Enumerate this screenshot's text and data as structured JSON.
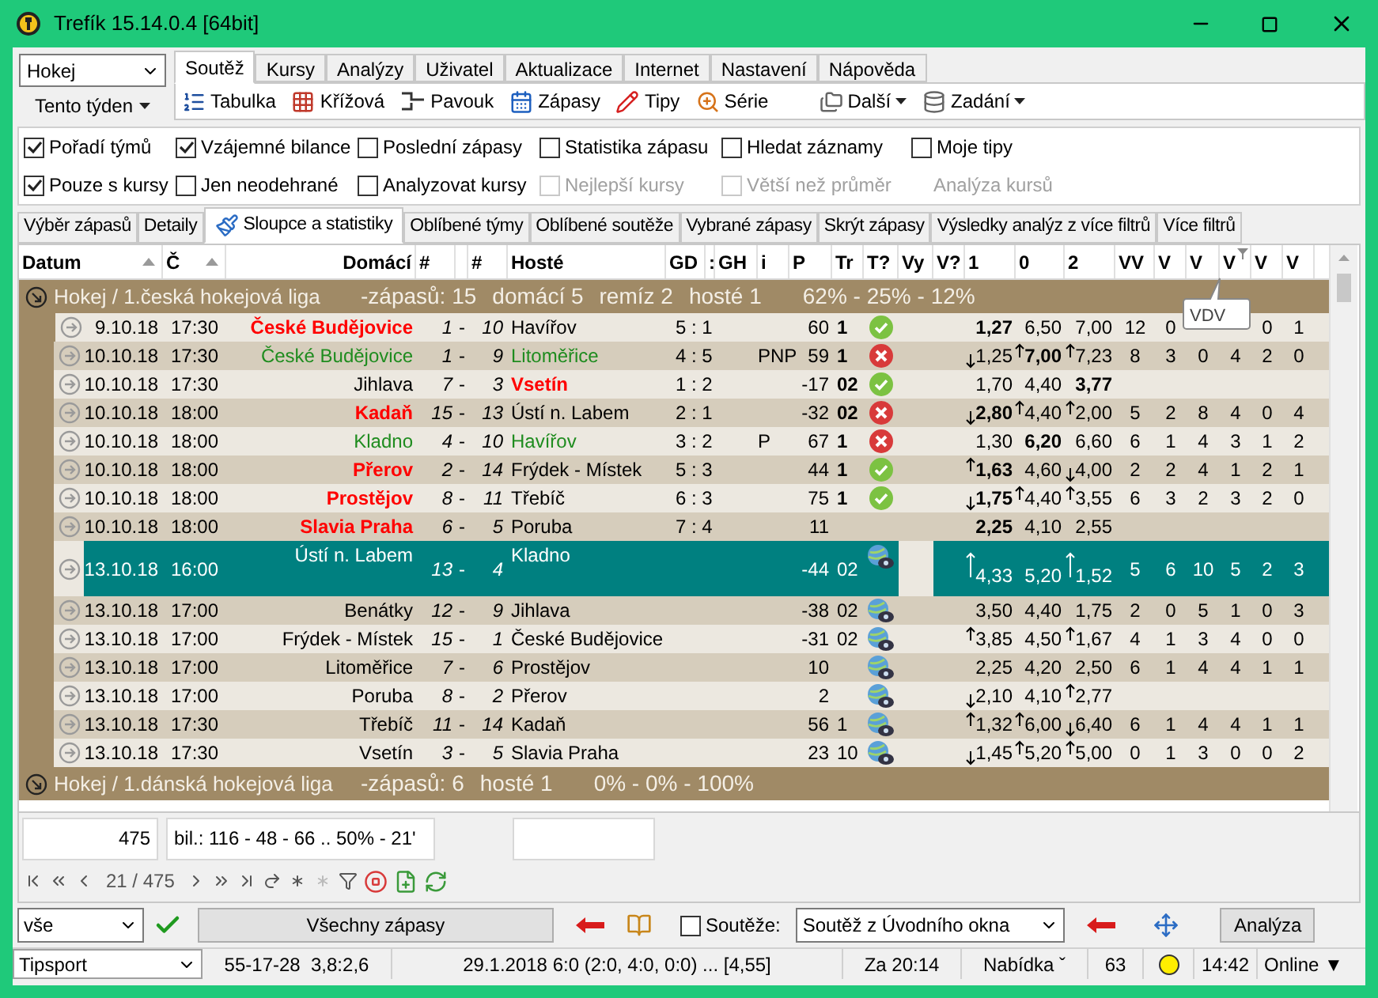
{
  "window": {
    "title": "Trefík 15.14.0.4 [64bit]"
  },
  "sport_select": {
    "value": "Hokej"
  },
  "period_button": {
    "label": "Tento týden"
  },
  "menu_tabs": [
    {
      "label": "Soutěž",
      "selected": true
    },
    {
      "label": "Kursy",
      "selected": false
    },
    {
      "label": "Analýzy",
      "selected": false
    },
    {
      "label": "Uživatel",
      "selected": false
    },
    {
      "label": "Aktualizace",
      "selected": false
    },
    {
      "label": "Internet",
      "selected": false
    },
    {
      "label": "Nastavení",
      "selected": false
    },
    {
      "label": "Nápověda",
      "selected": false
    }
  ],
  "toolbar": [
    {
      "label": "Tabulka",
      "dropdown": false
    },
    {
      "label": "Křížová",
      "dropdown": false
    },
    {
      "label": "Pavouk",
      "dropdown": false
    },
    {
      "label": "Zápasy",
      "dropdown": false
    },
    {
      "label": "Tipy",
      "dropdown": false
    },
    {
      "label": "Série",
      "dropdown": false
    },
    {
      "label": "Další",
      "dropdown": true
    },
    {
      "label": "Zadání",
      "dropdown": true
    }
  ],
  "options": [
    {
      "kind": "checkbox",
      "label": "Pořadí týmů",
      "checked": true,
      "disabled": false
    },
    {
      "kind": "checkbox",
      "label": "Vzájemné bilance",
      "checked": true,
      "disabled": false
    },
    {
      "kind": "checkbox",
      "label": "Poslední zápasy",
      "checked": false,
      "disabled": false
    },
    {
      "kind": "checkbox",
      "label": "Statistika zápasu",
      "checked": false,
      "disabled": false
    },
    {
      "kind": "checkbox",
      "label": "Hledat záznamy",
      "checked": false,
      "disabled": false
    },
    {
      "kind": "checkbox",
      "label": "Moje tipy",
      "checked": false,
      "disabled": false
    },
    {
      "kind": "checkbox",
      "label": "Pouze s kursy",
      "checked": true,
      "disabled": false
    },
    {
      "kind": "checkbox",
      "label": "Jen neodehrané",
      "checked": false,
      "disabled": false
    },
    {
      "kind": "checkbox",
      "label": "Analyzovat kursy",
      "checked": false,
      "disabled": false
    },
    {
      "kind": "checkbox",
      "label": "Nejlepší kursy",
      "checked": false,
      "disabled": true
    },
    {
      "kind": "checkbox",
      "label": "Větší než průměr",
      "checked": false,
      "disabled": true
    },
    {
      "kind": "label",
      "label": "Analýza kursů"
    }
  ],
  "sub_tabs": [
    {
      "label": "Výběr zápasů",
      "selected": false
    },
    {
      "label": "Detaily",
      "selected": false
    },
    {
      "label": "Sloupce a statistiky",
      "selected": true
    },
    {
      "label": "Oblíbené týmy",
      "selected": false
    },
    {
      "label": "Oblíbené soutěže",
      "selected": false
    },
    {
      "label": "Vybrané zápasy",
      "selected": false
    },
    {
      "label": "Skrýt zápasy",
      "selected": false
    },
    {
      "label": "Výsledky analýz z více filtrů",
      "selected": false
    },
    {
      "label": "Více filtrů",
      "selected": false
    }
  ],
  "table": {
    "columns": [
      {
        "label": "Datum",
        "sorted": true,
        "filtered": false
      },
      {
        "label": "Č",
        "sorted": true,
        "filtered": false
      },
      {
        "label": "Domácí",
        "sorted": false,
        "filtered": false
      },
      {
        "label": "#",
        "sorted": false,
        "filtered": false
      },
      {
        "sorted": false,
        "filtered": false
      },
      {
        "label": "#",
        "sorted": false,
        "filtered": false
      },
      {
        "label": "Hosté",
        "sorted": false,
        "filtered": false
      },
      {
        "label": "GD",
        "sorted": false,
        "filtered": false
      },
      {
        "label": ":",
        "sorted": false,
        "filtered": false
      },
      {
        "label": "GH",
        "sorted": false,
        "filtered": false
      },
      {
        "label": "i",
        "sorted": false,
        "filtered": false
      },
      {
        "label": "P",
        "sorted": false,
        "filtered": false
      },
      {
        "label": "Tr",
        "sorted": false,
        "filtered": false
      },
      {
        "label": "T?",
        "sorted": false,
        "filtered": false
      },
      {
        "label": "Vy",
        "sorted": false,
        "filtered": false
      },
      {
        "label": "V?",
        "sorted": false,
        "filtered": false
      },
      {
        "label": "1",
        "sorted": false,
        "filtered": false
      },
      {
        "label": "0",
        "sorted": false,
        "filtered": false
      },
      {
        "label": "2",
        "sorted": false,
        "filtered": false
      },
      {
        "label": "VV",
        "sorted": false,
        "filtered": false
      },
      {
        "label": "V",
        "sorted": false,
        "filtered": false
      },
      {
        "label": "V",
        "sorted": false,
        "filtered": false
      },
      {
        "label": "V",
        "sorted": false,
        "filtered": true
      },
      {
        "label": "V",
        "sorted": false,
        "filtered": false
      },
      {
        "label": "V",
        "sorted": false,
        "filtered": false
      }
    ],
    "groups": [
      {
        "title": "Hokej / 1.česká hokejová liga",
        "stats": [
          "-zápasů: 15",
          "domácí 5",
          "remíz 2",
          "hosté 1",
          "62% - 25% - 12%"
        ],
        "rows": [
          {
            "selected": false,
            "date": "9.10.18",
            "time": "17:30",
            "home": "České Budějovice",
            "home_red": true,
            "home_green": false,
            "home_score": "1",
            "sep": "-",
            "away_score": "10",
            "away": "Havířov",
            "away_red": false,
            "away_green": false,
            "gd": "5 : 1",
            "p": "60",
            "tr": "1",
            "result": {
              "kind": "ok"
            },
            "odds": [
              {
                "v": "1,27",
                "bold": true,
                "rising": false,
                "falling": false
              },
              {
                "v": "6,50",
                "bold": false,
                "rising": false,
                "falling": false
              },
              {
                "v": "7,00",
                "bold": false,
                "rising": false,
                "falling": false
              }
            ],
            "v": [
              "12",
              "0"
            ],
            "v_end": [
              "0",
              "1"
            ]
          },
          {
            "selected": false,
            "date": "10.10.18",
            "time": "17:30",
            "home": "České Budějovice",
            "home_red": false,
            "home_green": true,
            "home_score": "1",
            "sep": "-",
            "away_score": "9",
            "away": "Litoměřice",
            "away_red": false,
            "away_green": true,
            "gd": "4 : 5",
            "i": "PNP",
            "p": "59",
            "tr": "1",
            "result": {
              "kind": "fail"
            },
            "odds": [
              {
                "v": "1,25",
                "bold": false,
                "rising": false,
                "falling": true
              },
              {
                "v": "7,00",
                "bold": true,
                "rising": true,
                "falling": false
              },
              {
                "v": "7,23",
                "bold": false,
                "rising": true,
                "falling": false
              }
            ],
            "v": [
              "8",
              "3",
              "0",
              "4",
              "2",
              "0"
            ]
          },
          {
            "selected": false,
            "date": "10.10.18",
            "time": "17:30",
            "home": "Jihlava",
            "home_red": false,
            "home_green": false,
            "home_score": "7",
            "sep": "-",
            "away_score": "3",
            "away": "Vsetín",
            "away_red": true,
            "away_green": false,
            "gd": "1 : 2",
            "p": "-17",
            "tr": "02",
            "result": {
              "kind": "ok"
            },
            "odds": [
              {
                "v": "1,70",
                "bold": false,
                "rising": false,
                "falling": false
              },
              {
                "v": "4,40",
                "bold": false,
                "rising": false,
                "falling": false
              },
              {
                "v": "3,77",
                "bold": true,
                "rising": false,
                "falling": false
              }
            ]
          },
          {
            "selected": false,
            "date": "10.10.18",
            "time": "18:00",
            "home": "Kadaň",
            "home_red": true,
            "home_green": false,
            "home_score": "15",
            "sep": "-",
            "away_score": "13",
            "away": "Ústí n. Labem",
            "away_red": false,
            "away_green": false,
            "gd": "2 : 1",
            "p": "-32",
            "tr": "02",
            "result": {
              "kind": "fail"
            },
            "odds": [
              {
                "v": "2,80",
                "bold": true,
                "rising": false,
                "falling": true
              },
              {
                "v": "4,40",
                "bold": false,
                "rising": true,
                "falling": false
              },
              {
                "v": "2,00",
                "bold": false,
                "rising": true,
                "falling": false
              }
            ],
            "v": [
              "5",
              "2",
              "8",
              "4",
              "0",
              "4"
            ]
          },
          {
            "selected": false,
            "date": "10.10.18",
            "time": "18:00",
            "home": "Kladno",
            "home_red": false,
            "home_green": true,
            "home_score": "4",
            "sep": "-",
            "away_score": "10",
            "away": "Havířov",
            "away_red": false,
            "away_green": true,
            "gd": "3 : 2",
            "i": "P",
            "p": "67",
            "tr": "1",
            "result": {
              "kind": "fail"
            },
            "odds": [
              {
                "v": "1,30",
                "bold": false,
                "rising": false,
                "falling": false
              },
              {
                "v": "6,20",
                "bold": true,
                "rising": false,
                "falling": false
              },
              {
                "v": "6,60",
                "bold": false,
                "rising": false,
                "falling": false
              }
            ],
            "v": [
              "6",
              "1",
              "4",
              "3",
              "1",
              "2"
            ]
          },
          {
            "selected": false,
            "date": "10.10.18",
            "time": "18:00",
            "home": "Přerov",
            "home_red": true,
            "home_green": false,
            "home_score": "2",
            "sep": "-",
            "away_score": "14",
            "away": "Frýdek - Místek",
            "away_red": false,
            "away_green": false,
            "gd": "5 : 3",
            "p": "44",
            "tr": "1",
            "result": {
              "kind": "ok"
            },
            "odds": [
              {
                "v": "1,63",
                "bold": true,
                "rising": true,
                "falling": false
              },
              {
                "v": "4,60",
                "bold": false,
                "rising": false,
                "falling": false
              },
              {
                "v": "4,00",
                "bold": false,
                "rising": false,
                "falling": true
              }
            ],
            "v": [
              "2",
              "2",
              "4",
              "1",
              "2",
              "1"
            ]
          },
          {
            "selected": false,
            "date": "10.10.18",
            "time": "18:00",
            "home": "Prostějov",
            "home_red": true,
            "home_green": false,
            "home_score": "8",
            "sep": "-",
            "away_score": "11",
            "away": "Třebíč",
            "away_red": false,
            "away_green": false,
            "gd": "6 : 3",
            "p": "75",
            "tr": "1",
            "result": {
              "kind": "ok"
            },
            "odds": [
              {
                "v": "1,75",
                "bold": true,
                "rising": false,
                "falling": true
              },
              {
                "v": "4,40",
                "bold": false,
                "rising": true,
                "falling": false
              },
              {
                "v": "3,55",
                "bold": false,
                "rising": true,
                "falling": false
              }
            ],
            "v": [
              "6",
              "3",
              "2",
              "3",
              "2",
              "0"
            ]
          },
          {
            "selected": false,
            "date": "10.10.18",
            "time": "18:00",
            "home": "Slavia Praha",
            "home_red": true,
            "home_green": false,
            "home_score": "6",
            "sep": "-",
            "away_score": "5",
            "away": "Poruba",
            "away_red": false,
            "away_green": false,
            "gd": "7 : 4",
            "p": "11",
            "odds": [
              {
                "v": "2,25",
                "bold": true,
                "rising": false,
                "falling": false
              },
              {
                "v": "4,10",
                "bold": false,
                "rising": false,
                "falling": false
              },
              {
                "v": "2,55",
                "bold": false,
                "rising": false,
                "falling": false
              }
            ]
          },
          {
            "selected": true,
            "date": "13.10.18",
            "time": "16:00",
            "home": "Ústí n. Labem",
            "home_red": false,
            "home_green": false,
            "home_score": "13",
            "sep": "-",
            "away_score": "4",
            "away": "Kladno",
            "away_red": false,
            "away_green": false,
            "p": "-44",
            "tr": "02",
            "result": {
              "kind": "globe"
            },
            "odds": [
              {
                "v": "4,33",
                "bold": false,
                "rising": true,
                "falling": false
              },
              {
                "v": "5,20",
                "bold": false,
                "rising": false,
                "falling": false
              },
              {
                "v": "1,52",
                "bold": false,
                "rising": true,
                "falling": false
              }
            ],
            "v": [
              "5",
              "6",
              "10",
              "5",
              "2",
              "3"
            ]
          },
          {
            "selected": false,
            "date": "13.10.18",
            "time": "17:00",
            "home": "Benátky",
            "home_red": false,
            "home_green": false,
            "home_score": "12",
            "sep": "-",
            "away_score": "9",
            "away": "Jihlava",
            "away_red": false,
            "away_green": false,
            "p": "-38",
            "tr": "02",
            "result": {
              "kind": "globe"
            },
            "odds": [
              {
                "v": "3,50",
                "bold": false,
                "rising": false,
                "falling": false
              },
              {
                "v": "4,40",
                "bold": false,
                "rising": false,
                "falling": false
              },
              {
                "v": "1,75",
                "bold": false,
                "rising": false,
                "falling": false
              }
            ],
            "v": [
              "2",
              "0",
              "5",
              "1",
              "0",
              "3"
            ]
          },
          {
            "selected": false,
            "date": "13.10.18",
            "time": "17:00",
            "home": "Frýdek - Místek",
            "home_red": false,
            "home_green": false,
            "home_score": "15",
            "sep": "-",
            "away_score": "1",
            "away": "České Budějovice",
            "away_red": false,
            "away_green": false,
            "p": "-31",
            "tr": "02",
            "result": {
              "kind": "globe"
            },
            "odds": [
              {
                "v": "3,85",
                "bold": false,
                "rising": true,
                "falling": false
              },
              {
                "v": "4,50",
                "bold": false,
                "rising": false,
                "falling": false
              },
              {
                "v": "1,67",
                "bold": false,
                "rising": true,
                "falling": false
              }
            ],
            "v": [
              "4",
              "1",
              "3",
              "4",
              "0",
              "0"
            ]
          },
          {
            "selected": false,
            "date": "13.10.18",
            "time": "17:00",
            "home": "Litoměřice",
            "home_red": false,
            "home_green": false,
            "home_score": "7",
            "sep": "-",
            "away_score": "6",
            "away": "Prostějov",
            "away_red": false,
            "away_green": false,
            "p": "10",
            "result": {
              "kind": "globe"
            },
            "odds": [
              {
                "v": "2,25",
                "bold": false,
                "rising": false,
                "falling": false
              },
              {
                "v": "4,20",
                "bold": false,
                "rising": false,
                "falling": false
              },
              {
                "v": "2,50",
                "bold": false,
                "rising": false,
                "falling": false
              }
            ],
            "v": [
              "6",
              "1",
              "4",
              "4",
              "1",
              "1"
            ]
          },
          {
            "selected": false,
            "date": "13.10.18",
            "time": "17:00",
            "home": "Poruba",
            "home_red": false,
            "home_green": false,
            "home_score": "8",
            "sep": "-",
            "away_score": "2",
            "away": "Přerov",
            "away_red": false,
            "away_green": false,
            "p": "2",
            "result": {
              "kind": "globe"
            },
            "odds": [
              {
                "v": "2,10",
                "bold": false,
                "rising": false,
                "falling": true
              },
              {
                "v": "4,10",
                "bold": false,
                "rising": false,
                "falling": false
              },
              {
                "v": "2,77",
                "bold": false,
                "rising": true,
                "falling": false
              }
            ]
          },
          {
            "selected": false,
            "date": "13.10.18",
            "time": "17:30",
            "home": "Třebíč",
            "home_red": false,
            "home_green": false,
            "home_score": "11",
            "sep": "-",
            "away_score": "14",
            "away": "Kadaň",
            "away_red": false,
            "away_green": false,
            "p": "56",
            "tr": "1",
            "result": {
              "kind": "globe"
            },
            "odds": [
              {
                "v": "1,32",
                "bold": false,
                "rising": true,
                "falling": false
              },
              {
                "v": "6,00",
                "bold": false,
                "rising": true,
                "falling": false
              },
              {
                "v": "6,40",
                "bold": false,
                "rising": false,
                "falling": true
              }
            ],
            "v": [
              "6",
              "1",
              "4",
              "4",
              "1",
              "1"
            ]
          },
          {
            "selected": false,
            "date": "13.10.18",
            "time": "17:30",
            "home": "Vsetín",
            "home_red": false,
            "home_green": false,
            "home_score": "3",
            "sep": "-",
            "away_score": "5",
            "away": "Slavia Praha",
            "away_red": false,
            "away_green": false,
            "p": "23",
            "tr": "10",
            "result": {
              "kind": "globe"
            },
            "odds": [
              {
                "v": "1,45",
                "bold": false,
                "rising": false,
                "falling": true
              },
              {
                "v": "5,20",
                "bold": false,
                "rising": true,
                "falling": false
              },
              {
                "v": "5,00",
                "bold": false,
                "rising": true,
                "falling": false
              }
            ],
            "v": [
              "0",
              "1",
              "3",
              "0",
              "0",
              "2"
            ]
          }
        ]
      },
      {
        "title": "Hokej / 1.dánská hokejová liga",
        "stats": [
          "-zápasů: 6",
          "hosté 1",
          "0% - 0% - 100%"
        ]
      }
    ],
    "tooltip": "VDV"
  },
  "footer": {
    "count": "475",
    "balance": "bil.: 116 - 48 - 66 .. 50% - 21'",
    "position": "21 / 475"
  },
  "bottom_bar": {
    "filter": "vše",
    "all_button": "Všechny zápasy",
    "competitions": {
      "label": "Soutěže:",
      "checked": false
    },
    "competition_select": "Soutěž z Úvodního okna",
    "analysis_button": "Analýza"
  },
  "status_bar": {
    "bookmaker": "Tipsport",
    "cells": [
      "55-17-28  3,8:2,6",
      "29.1.2018 6:0 (2:0, 4:0, 0:0) ... [4,55]",
      "Za 20:14",
      "Nabídka ˇ",
      "63"
    ],
    "clock": "14:42",
    "connection": "Online ▼"
  }
}
